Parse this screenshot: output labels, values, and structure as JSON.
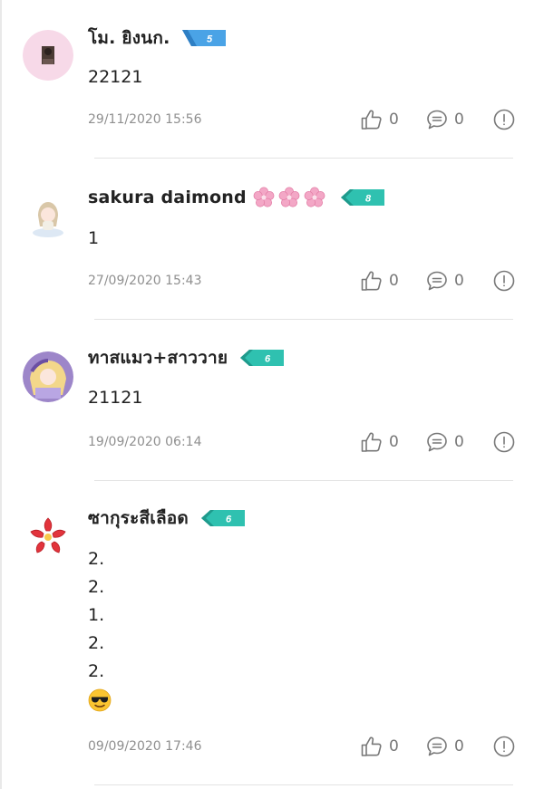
{
  "comments": [
    {
      "username": "โม. ยิงนก.",
      "level": "5",
      "content": [
        "22121"
      ],
      "timestamp": "29/11/2020 15:56",
      "likes": "0",
      "replies": "0",
      "badge_color": "#4aa3e6"
    },
    {
      "username": "sakura daimond",
      "level": "8",
      "content": [
        "1"
      ],
      "timestamp": "27/09/2020 15:43",
      "likes": "0",
      "replies": "0",
      "badge_color": "#2fc1b0"
    },
    {
      "username": "ทาสแมว+สาววาย",
      "level": "6",
      "content": [
        "21121"
      ],
      "timestamp": "19/09/2020 06:14",
      "likes": "0",
      "replies": "0",
      "badge_color": "#2fc1b0"
    },
    {
      "username": "ซากุระสีเลือด",
      "level": "6",
      "content": [
        "2.",
        "2.",
        "1.",
        "2.",
        "2."
      ],
      "content_emoji": "smiling-face-with-sunglasses",
      "timestamp": "09/09/2020 17:46",
      "likes": "0",
      "replies": "0",
      "badge_color": "#2fc1b0"
    }
  ],
  "icons": {
    "like": "thumbs-up-icon",
    "reply": "speech-bubble-icon",
    "report": "exclamation-circle-icon",
    "decoration": "cherry-blossom-icon"
  }
}
